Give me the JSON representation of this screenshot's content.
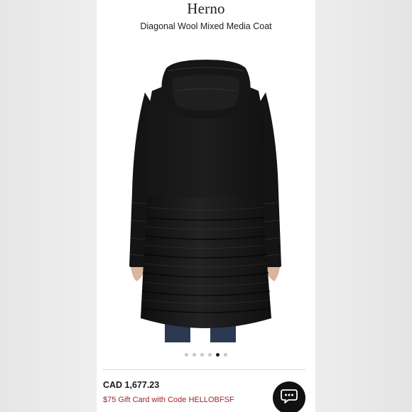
{
  "header": {
    "brand": "Herno",
    "product_title": "Diagonal Wool Mixed Media Coat"
  },
  "gallery": {
    "image_icon": "black-hooded-coat-back-view",
    "dot_count": 6,
    "active_dot_index": 4
  },
  "pricing": {
    "price": "CAD 1,677.23",
    "promo": "$75 Gift Card with Code HELLOBFSF"
  },
  "chat": {
    "icon": "chat-bubble-icon"
  },
  "colors": {
    "promo": "#a2262a",
    "chat_bg": "#111111",
    "active_dot": "#1a1a1a"
  }
}
